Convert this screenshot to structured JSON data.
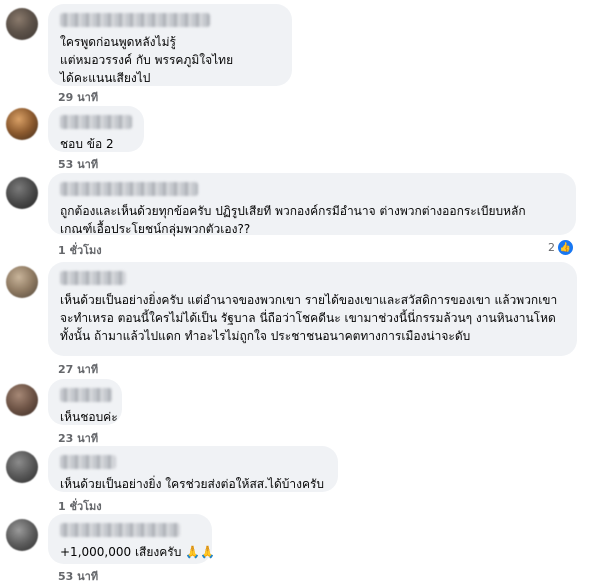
{
  "comments": [
    {
      "lines": [
        "ใครพูดก่อนพูดหลังไม่รู้",
        "แต่หมอวรรงค์ กับ พรรคภูมิใจไทย",
        "ได้คะแนนเสียงไป"
      ],
      "time": "29 นาที"
    },
    {
      "lines": [
        "ชอบ ข้อ 2"
      ],
      "time": "53 นาที"
    },
    {
      "lines": [
        "ถูกต้องและเห็นด้วยทุกข้อครับ ปฏิรูปเสียที พวกองค์กรมีอำนาจ ต่างพวกต่างออกระเบียบหลัก",
        "เกณฑ์เอื้อประโยชน์กลุ่มพวกตัวเอง??"
      ],
      "time": "1 ชั่วโมง",
      "reactions": "2"
    },
    {
      "lines": [
        "เห็นด้วยเป็นอย่างยิ่งครับ แต่อำนาจของพวกเขา รายได้ของเขาและสวัสดิการของเขา แล้วพวกเขา",
        "จะทำเหรอ ตอนนี้ใครไม่ได้เป็น รัฐบาล นี่ถือว่าโชคดีนะ เขามาช่วงนี้นี่กรรมล้วนๆ งานหินงานโหด",
        "ทั้งนั้น ถ้ามาแล้วไปแดก ทำอะไรไม่ถูกใจ ประชาชนอนาคตทางการเมืองน่าจะดับ"
      ],
      "time": "27 นาที"
    },
    {
      "lines": [
        "เห็นชอบค่ะ"
      ],
      "time": "23 นาที"
    },
    {
      "lines": [
        "เห็นด้วยเป็นอย่างยิ่ง ใครช่วยส่งต่อให้สส.ได้บ้างครับ"
      ],
      "time": "1 ชั่วโมง"
    },
    {
      "lines": [
        "+1,000,000 เสียงครับ 🙏🙏"
      ],
      "time": "53 นาที"
    }
  ],
  "icons": {
    "reaction": "like-icon",
    "avatar": "avatar"
  },
  "colors": {
    "bubble": "#f0f2f5",
    "meta": "#65676b",
    "like": "#1877f2"
  }
}
